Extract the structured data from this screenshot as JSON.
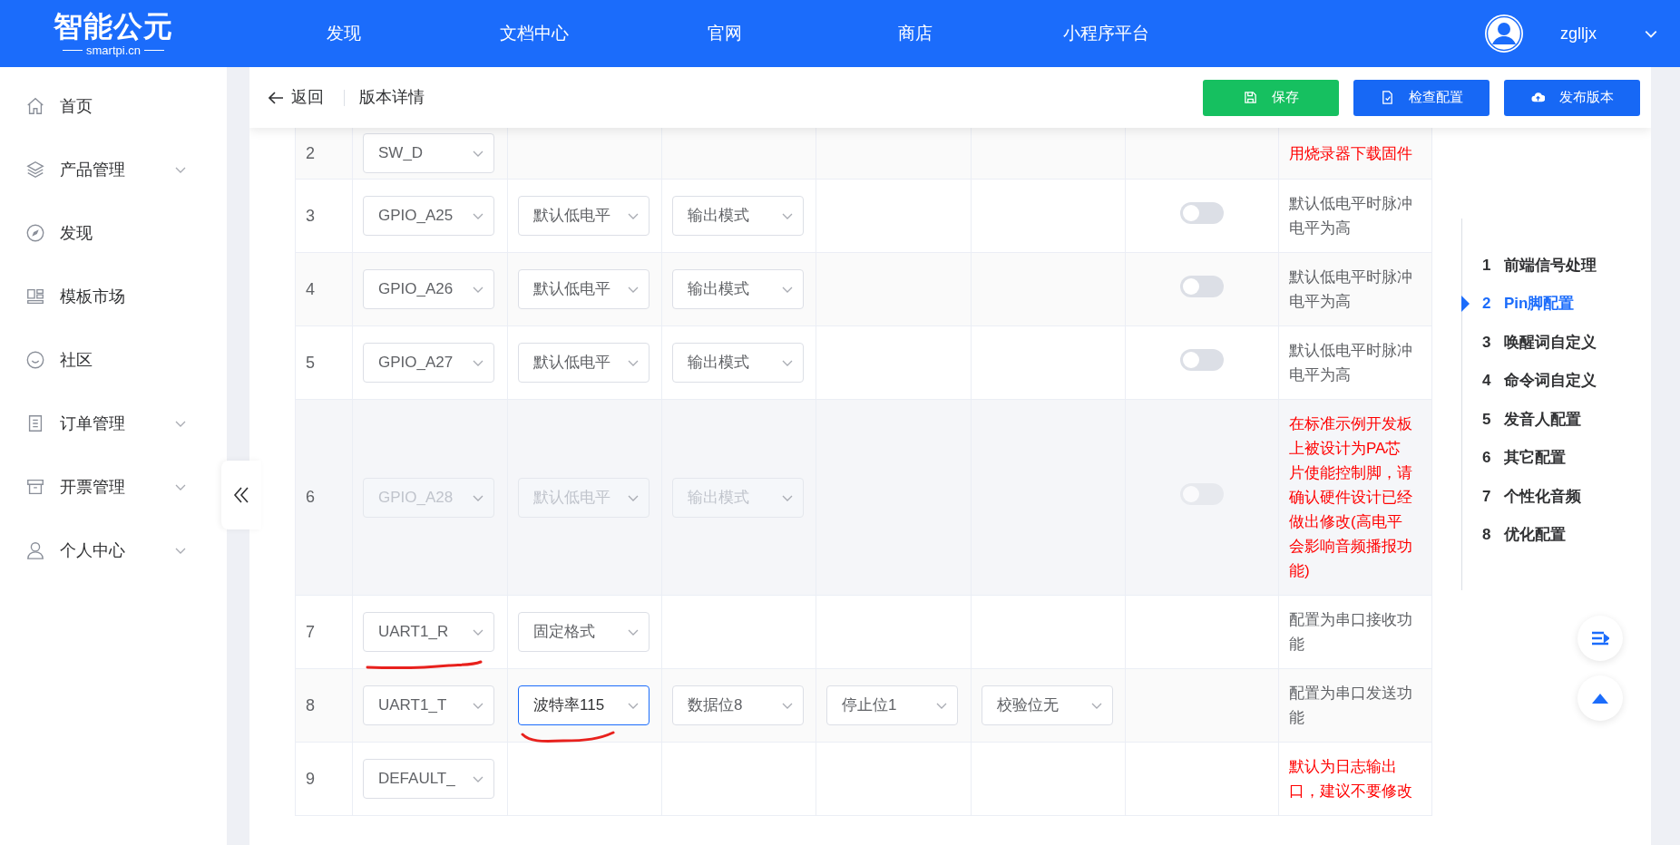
{
  "logo": {
    "name": "智能公元",
    "domain": "smartpi.cn"
  },
  "top_nav": [
    {
      "label": "发现"
    },
    {
      "label": "文档中心"
    },
    {
      "label": "官网"
    },
    {
      "label": "商店"
    },
    {
      "label": "小程序平台"
    }
  ],
  "user": {
    "name": "zglljx"
  },
  "sidebar": {
    "items": [
      {
        "label": "首页",
        "has_submenu": false
      },
      {
        "label": "产品管理",
        "has_submenu": true
      },
      {
        "label": "发现",
        "has_submenu": false
      },
      {
        "label": "模板市场",
        "has_submenu": false
      },
      {
        "label": "社区",
        "has_submenu": false
      },
      {
        "label": "订单管理",
        "has_submenu": true
      },
      {
        "label": "开票管理",
        "has_submenu": true
      },
      {
        "label": "个人中心",
        "has_submenu": true
      }
    ]
  },
  "page_header": {
    "back_label": "返回",
    "title": "版本详情",
    "buttons": [
      {
        "label": "保存",
        "kind": "save"
      },
      {
        "label": "检查配置",
        "kind": "check"
      },
      {
        "label": "发布版本",
        "kind": "publish"
      }
    ]
  },
  "table": {
    "rows": [
      {
        "index": "2",
        "disabled": false,
        "selects": [
          {
            "value": "SW_D",
            "focused": false
          }
        ],
        "note": "用烧录器下载固件",
        "warning": true
      },
      {
        "index": "3",
        "disabled": false,
        "selects": [
          {
            "value": "GPIO_A25",
            "focused": false
          },
          {
            "value": "默认低电平",
            "focused": false
          },
          {
            "value": "输出模式",
            "focused": false
          }
        ],
        "switch": {
          "on": false
        },
        "note": "默认低电平时脉冲电平为高",
        "warning": false
      },
      {
        "index": "4",
        "disabled": false,
        "selects": [
          {
            "value": "GPIO_A26",
            "focused": false
          },
          {
            "value": "默认低电平",
            "focused": false
          },
          {
            "value": "输出模式",
            "focused": false
          }
        ],
        "switch": {
          "on": false
        },
        "note": "默认低电平时脉冲电平为高",
        "warning": false
      },
      {
        "index": "5",
        "disabled": false,
        "selects": [
          {
            "value": "GPIO_A27",
            "focused": false
          },
          {
            "value": "默认低电平",
            "focused": false
          },
          {
            "value": "输出模式",
            "focused": false
          }
        ],
        "switch": {
          "on": false
        },
        "note": "默认低电平时脉冲电平为高",
        "warning": false
      },
      {
        "index": "6",
        "disabled": true,
        "selects": [
          {
            "value": "GPIO_A28",
            "focused": false
          },
          {
            "value": "默认低电平",
            "focused": false
          },
          {
            "value": "输出模式",
            "focused": false
          }
        ],
        "switch": {
          "on": false
        },
        "note": "在标准示例开发板上被设计为PA芯片使能控制脚，请确认硬件设计已经做出修改(高电平会影响音频播报功能)",
        "warning": true
      },
      {
        "index": "7",
        "disabled": false,
        "selects": [
          {
            "value": "UART1_R",
            "focused": false
          },
          {
            "value": "固定格式",
            "focused": false
          }
        ],
        "note": "配置为串口接收功能",
        "warning": false
      },
      {
        "index": "8",
        "disabled": false,
        "selects": [
          {
            "value": "UART1_T",
            "focused": false
          },
          {
            "value": "波特率115",
            "focused": true
          },
          {
            "value": "数据位8",
            "focused": false
          },
          {
            "value": "停止位1",
            "focused": false
          },
          {
            "value": "校验位无",
            "focused": false
          }
        ],
        "note": "配置为串口发送功能",
        "warning": false
      },
      {
        "index": "9",
        "disabled": false,
        "selects": [
          {
            "value": "DEFAULT_",
            "focused": false
          }
        ],
        "note": "默认为日志输出口，建议不要修改",
        "warning": true
      }
    ]
  },
  "steps": [
    {
      "number": "1",
      "label": "前端信号处理",
      "selected": false
    },
    {
      "number": "2",
      "label": "Pin脚配置",
      "selected": true
    },
    {
      "number": "3",
      "label": "唤醒词自定义",
      "selected": false
    },
    {
      "number": "4",
      "label": "命令词自定义",
      "selected": false
    },
    {
      "number": "5",
      "label": "发音人配置",
      "selected": false
    },
    {
      "number": "6",
      "label": "其它配置",
      "selected": false
    },
    {
      "number": "7",
      "label": "个性化音频",
      "selected": false
    },
    {
      "number": "8",
      "label": "优化配置",
      "selected": false
    }
  ]
}
